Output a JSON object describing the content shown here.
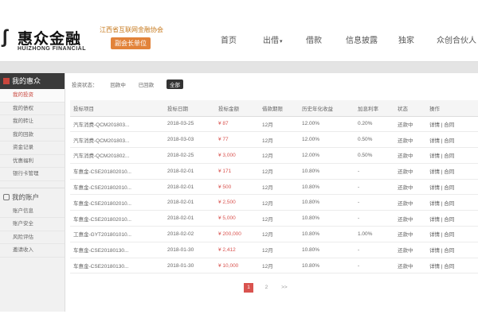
{
  "brand": {
    "cn": "惠众金融",
    "en": "HUIZHONG FINANCIAL"
  },
  "promo": {
    "title": "江西省互联网金融协会",
    "button": "副会长单位"
  },
  "nav": [
    {
      "label": "首页",
      "caret": ""
    },
    {
      "label": "出借",
      "caret": "▾"
    },
    {
      "label": "借款",
      "caret": ""
    },
    {
      "label": "信息披露",
      "caret": ""
    },
    {
      "label": "独家",
      "caret": ""
    },
    {
      "label": "众创合伙人",
      "caret": ""
    }
  ],
  "sidebar": {
    "header": "我的惠众",
    "items": [
      "我的投资",
      "我的债权",
      "我的转让",
      "我的回款",
      "资金记录",
      "优惠福利",
      "银行卡管理"
    ],
    "account_header": "我的账户",
    "account_items": [
      "账户信息",
      "账户安全",
      "风险评估",
      "邀请收入"
    ]
  },
  "filter": {
    "label": "投资状态：",
    "options": [
      "回款中",
      "已回款",
      "全部"
    ]
  },
  "table": {
    "headers": [
      "投标项目",
      "投标日期",
      "投标金额",
      "借款期限",
      "历史年化收益",
      "加息利率",
      "状态",
      "操作"
    ],
    "rows": [
      [
        "汽车消费-QCM201803...",
        "2018-03-25",
        "¥ 87",
        "12月",
        "12.00%",
        "0.20%",
        "还款中",
        "详情 | 合同"
      ],
      [
        "汽车消费-QCM201803...",
        "2018-03-03",
        "¥ 77",
        "12月",
        "12.00%",
        "0.50%",
        "还款中",
        "详情 | 合同"
      ],
      [
        "汽车消费-QCM201802...",
        "2018-02-25",
        "¥ 3,000",
        "12月",
        "12.00%",
        "0.50%",
        "还款中",
        "详情 | 合同"
      ],
      [
        "车惠金-CSE201802010...",
        "2018-02-01",
        "¥ 171",
        "12月",
        "10.80%",
        "-",
        "还款中",
        "详情 | 合同"
      ],
      [
        "车惠金-CSE201802010...",
        "2018-02-01",
        "¥ 500",
        "12月",
        "10.80%",
        "-",
        "还款中",
        "详情 | 合同"
      ],
      [
        "车惠金-CSE201802010...",
        "2018-02-01",
        "¥ 2,500",
        "12月",
        "10.80%",
        "-",
        "还款中",
        "详情 | 合同"
      ],
      [
        "车惠金-CSE201802010...",
        "2018-02-01",
        "¥ 5,000",
        "12月",
        "10.80%",
        "-",
        "还款中",
        "详情 | 合同"
      ],
      [
        "工惠金-GYT201801010...",
        "2018-02-02",
        "¥ 200,000",
        "12月",
        "10.80%",
        "1.00%",
        "还款中",
        "详情 | 合同"
      ],
      [
        "车惠金-CSE20180130...",
        "2018-01-30",
        "¥ 2,412",
        "12月",
        "10.80%",
        "-",
        "还款中",
        "详情 | 合同"
      ],
      [
        "车惠金-CSE20180130...",
        "2018-01-30",
        "¥ 10,000",
        "12月",
        "10.80%",
        "-",
        "还款中",
        "详情 | 合同"
      ]
    ]
  },
  "pager": {
    "current": "1",
    "next": "2",
    "more": ">>"
  },
  "colors": {
    "accent": "#d9534f",
    "sidebar_header": "#3a3a3a",
    "promo": "#e2833a"
  }
}
